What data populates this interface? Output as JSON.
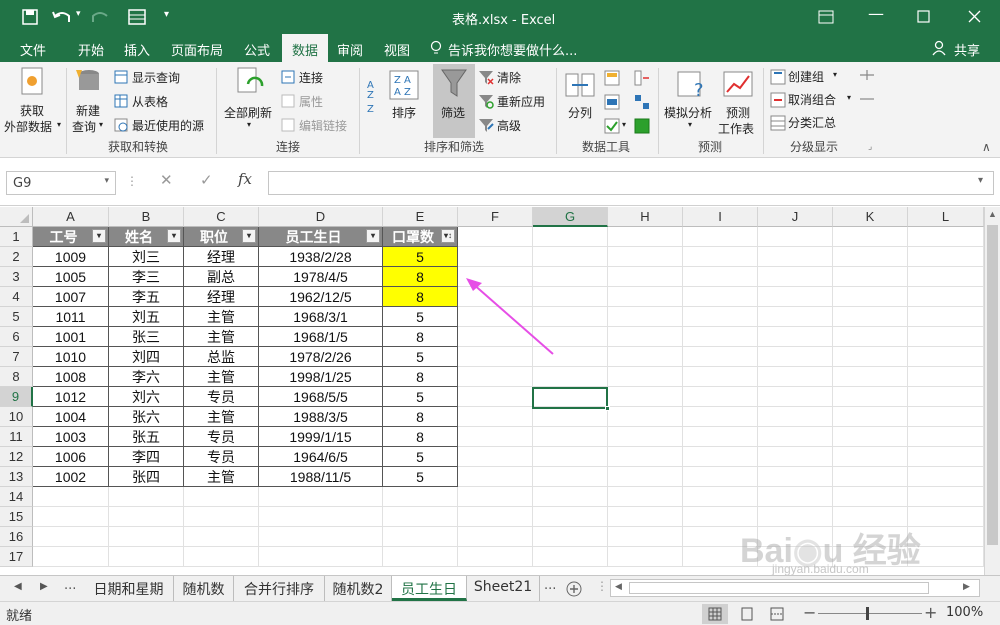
{
  "title": "表格.xlsx - Excel",
  "menus": [
    "文件",
    "开始",
    "插入",
    "页面布局",
    "公式",
    "数据",
    "审阅",
    "视图"
  ],
  "tell_me": "告诉我你想要做什么...",
  "share": "共享",
  "ribbon": {
    "get_external": [
      "获取",
      "外部数据"
    ],
    "new_query": [
      "新建",
      "查询"
    ],
    "show_query": "显示查询",
    "from_table": "从表格",
    "recent_sources": "最近使用的源",
    "group_get_transform": "获取和转换",
    "refresh_all": "全部刷新",
    "connections": "连接",
    "properties": "属性",
    "edit_links": "编辑链接",
    "group_connections": "连接",
    "sort": "排序",
    "filter": "筛选",
    "clear": "清除",
    "reapply": "重新应用",
    "advanced": "高级",
    "group_sort_filter": "排序和筛选",
    "split_column": "分列",
    "group_data_tools": "数据工具",
    "what_if": "模拟分析",
    "forecast_sheet": [
      "预测",
      "工作表"
    ],
    "group_forecast": "预测",
    "group_btn": "创建组",
    "ungroup": "取消组合",
    "subtotal": "分类汇总",
    "group_outline": "分级显示"
  },
  "name_box": "G9",
  "fx": "fx",
  "columns": [
    "A",
    "B",
    "C",
    "D",
    "E",
    "F",
    "G",
    "H",
    "I",
    "J",
    "K",
    "L"
  ],
  "rows": [
    "1",
    "2",
    "3",
    "4",
    "5",
    "6",
    "7",
    "8",
    "9",
    "10",
    "11",
    "12",
    "13",
    "14",
    "15",
    "16",
    "17"
  ],
  "headers": [
    "工号",
    "姓名",
    "职位",
    "员工生日",
    "口罩数"
  ],
  "table": [
    [
      "1009",
      "刘三",
      "经理",
      "1938/2/28",
      "5"
    ],
    [
      "1005",
      "李三",
      "副总",
      "1978/4/5",
      "8"
    ],
    [
      "1007",
      "李五",
      "经理",
      "1962/12/5",
      "8"
    ],
    [
      "1011",
      "刘五",
      "主管",
      "1968/3/1",
      "5"
    ],
    [
      "1001",
      "张三",
      "主管",
      "1968/1/5",
      "8"
    ],
    [
      "1010",
      "刘四",
      "总监",
      "1978/2/26",
      "5"
    ],
    [
      "1008",
      "李六",
      "主管",
      "1998/1/25",
      "8"
    ],
    [
      "1012",
      "刘六",
      "专员",
      "1968/5/5",
      "5"
    ],
    [
      "1004",
      "张六",
      "主管",
      "1988/3/5",
      "8"
    ],
    [
      "1003",
      "张五",
      "专员",
      "1999/1/15",
      "8"
    ],
    [
      "1006",
      "李四",
      "专员",
      "1964/6/5",
      "5"
    ],
    [
      "1002",
      "张四",
      "主管",
      "1988/11/5",
      "5"
    ]
  ],
  "sheet_tabs": [
    "日期和星期",
    "随机数",
    "合并行排序",
    "随机数2",
    "员工生日",
    "Sheet21"
  ],
  "tab_more": "...",
  "status_ready": "就绪",
  "zoom": "100%",
  "colors": {
    "excel_green": "#217346",
    "highlight": "#ffff00",
    "arrow": "#e64ee6",
    "header_fill": "#888888"
  }
}
